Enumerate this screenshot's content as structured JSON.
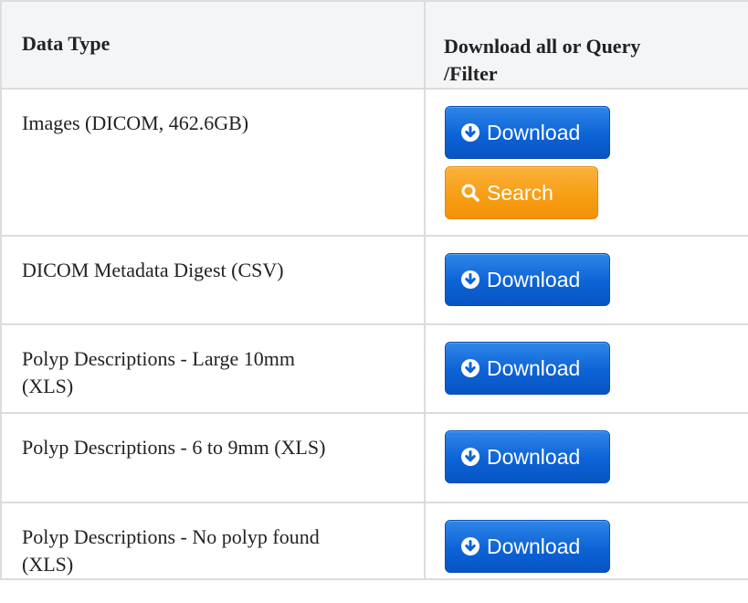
{
  "table": {
    "headers": [
      "Data Type",
      "Download all or Query\n/Filter"
    ],
    "header_col2_line1": "Download all or Query",
    "header_col2_line2": "/Filter",
    "rows": [
      {
        "data_type": "Images (DICOM, 462.6GB)",
        "buttons": [
          "Download",
          "Search"
        ]
      },
      {
        "data_type": "DICOM Metadata Digest (CSV)",
        "buttons": [
          "Download"
        ]
      },
      {
        "data_type_line1": "Polyp Descriptions - Large 10mm",
        "data_type_line2": "(XLS)",
        "buttons": [
          "Download"
        ]
      },
      {
        "data_type": "Polyp Descriptions - 6 to 9mm (XLS)",
        "buttons": [
          "Download"
        ]
      },
      {
        "data_type_line1": "Polyp Descriptions - No polyp found",
        "data_type_line2": "(XLS)",
        "buttons": [
          "Download"
        ]
      }
    ]
  },
  "labels": {
    "download": "Download",
    "search": "Search"
  },
  "icons": {
    "download": "arrow-circle-down-icon",
    "search": "magnifier-icon"
  },
  "colors": {
    "download_button": "#0d63d6",
    "search_button": "#f79d12",
    "header_background": "#f4f5f7",
    "border": "#dcdcdc"
  }
}
